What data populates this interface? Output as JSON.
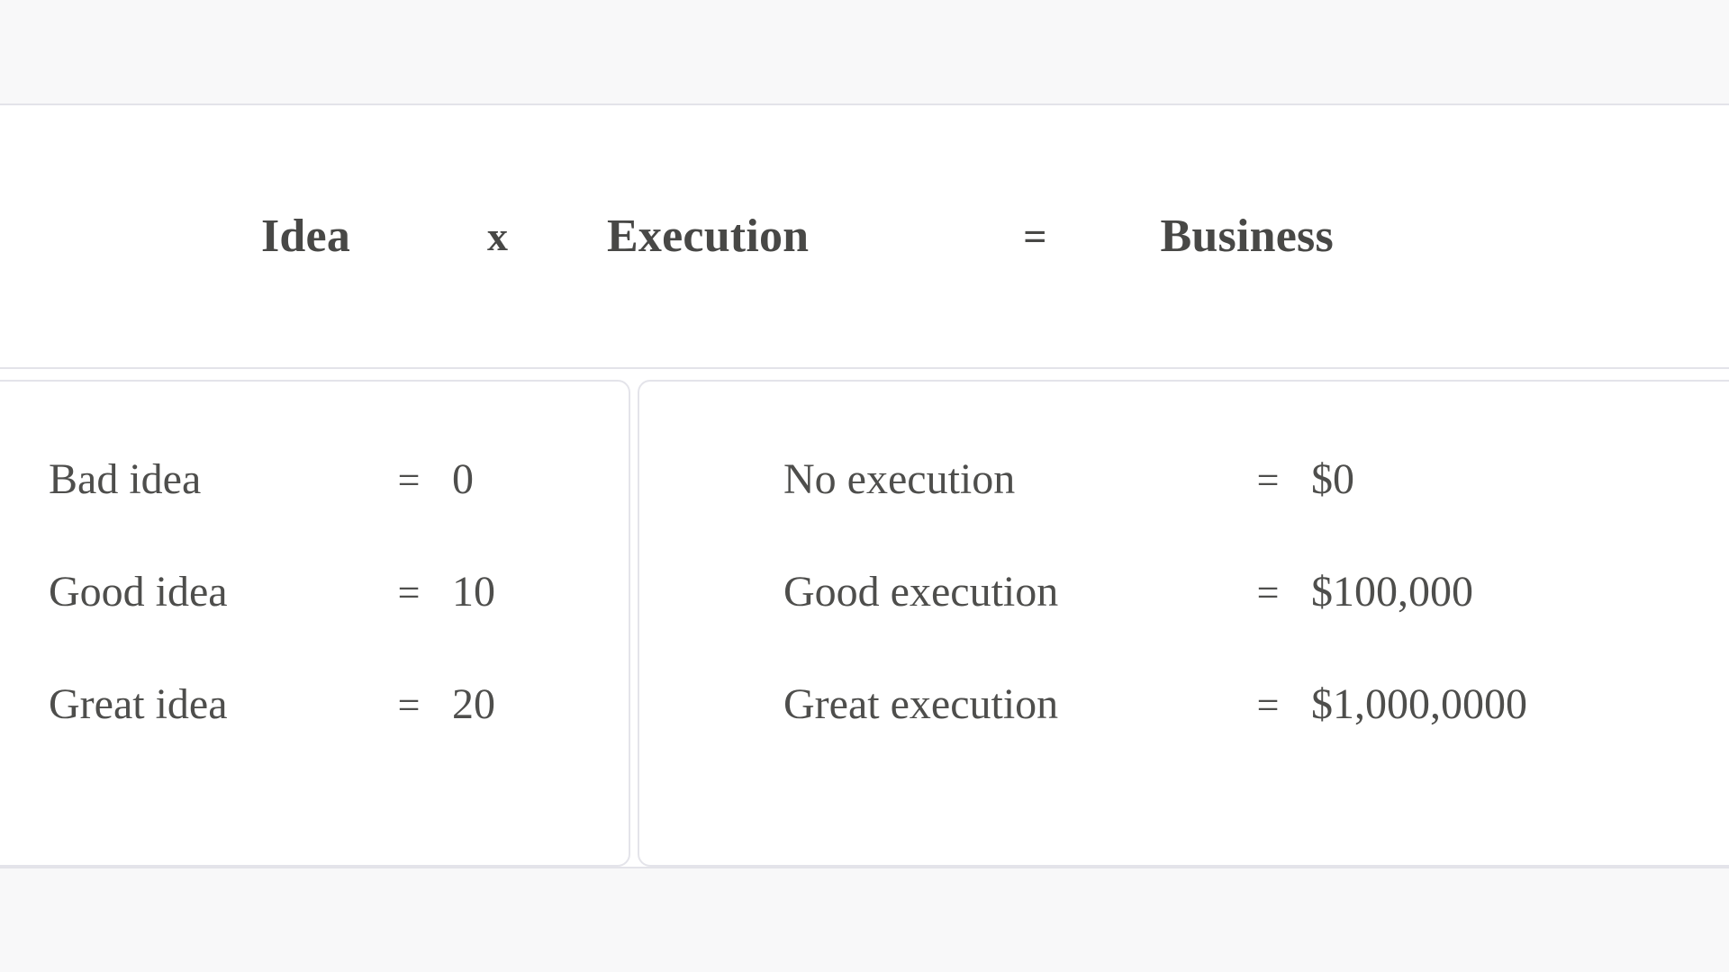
{
  "page": {
    "background_color": "#f8f8f9",
    "card_background_color": "#ffffff",
    "border_color": "#e4e4ea",
    "text_color": "#4e4e4c"
  },
  "header": {
    "term_idea": "Idea",
    "operator_multiply": "x",
    "term_execution": "Execution",
    "operator_equals": "=",
    "term_business": "Business"
  },
  "idea_panel": {
    "rows": [
      {
        "label": "Bad idea",
        "equals": "=",
        "value": "0"
      },
      {
        "label": "Good idea",
        "equals": "=",
        "value": "10"
      },
      {
        "label": "Great idea",
        "equals": "=",
        "value": "20"
      }
    ]
  },
  "execution_panel": {
    "rows": [
      {
        "label": "No execution",
        "equals": "=",
        "value": "$0"
      },
      {
        "label": "Good execution",
        "equals": "=",
        "value": "$100,000"
      },
      {
        "label": "Great execution",
        "equals": "=",
        "value": "$1,000,0000"
      }
    ]
  }
}
